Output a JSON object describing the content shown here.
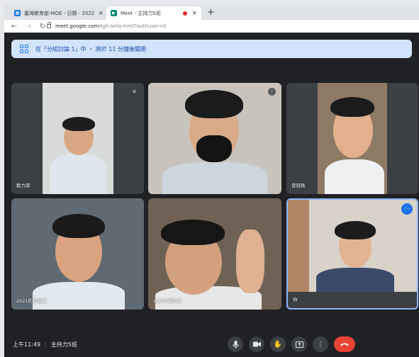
{
  "browser": {
    "tabs": [
      {
        "title": "臺灣教育部-MOE - 日曆 - 2022",
        "active": false
      },
      {
        "title": "Meet - 主持力5班",
        "active": true
      }
    ],
    "new_tab_symbol": "+",
    "close_symbol": "×",
    "url_host": "meet.google.com",
    "url_path": "/tgh-sefq-mmf?authuser=0"
  },
  "banner": {
    "text": "在「分組討論 1」中 ・ 將於 11 分鐘後關閉"
  },
  "participants": [
    {
      "name": "劉力諺",
      "muted": true
    },
    {
      "name": "",
      "muted": false
    },
    {
      "name": "曾冠銘",
      "muted": false
    },
    {
      "name": "2021的蔡德耀",
      "muted": false
    },
    {
      "name": "21907郭宇昇",
      "muted": false
    },
    {
      "name": "你",
      "muted": false,
      "selected": true
    }
  ],
  "bottom": {
    "time": "上午11:49",
    "separator": "|",
    "meeting_name": "主持力5班"
  },
  "colors": {
    "meet_bg": "#202124",
    "banner_bg": "#d2e3fc",
    "accent": "#1a73e8",
    "end_call": "#ea4335"
  }
}
